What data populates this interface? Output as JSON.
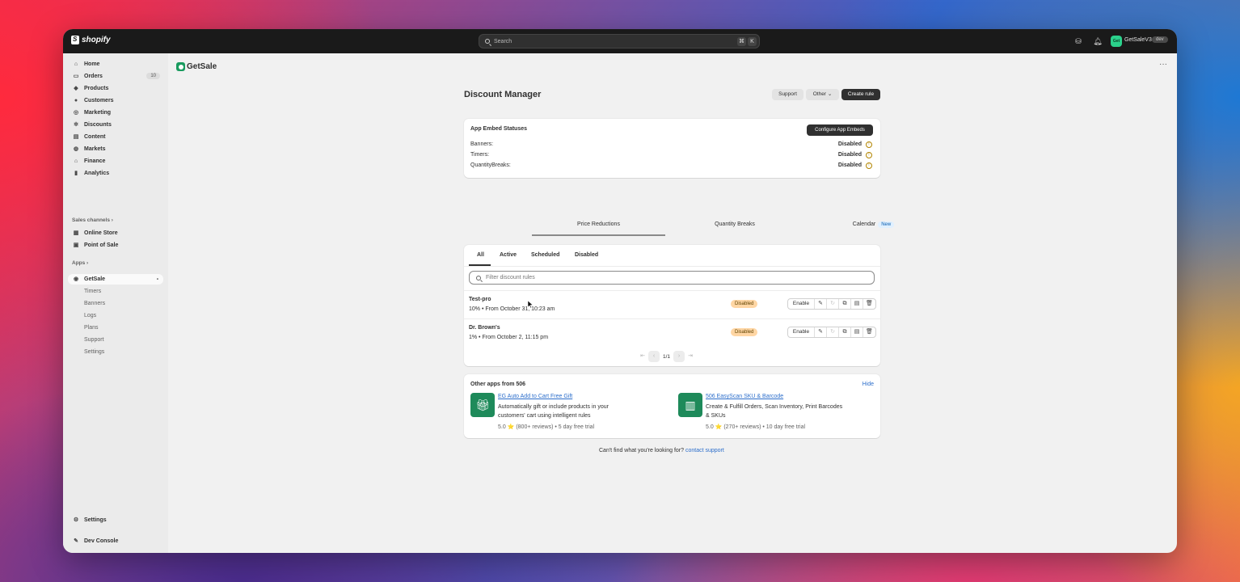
{
  "topbar": {
    "brand": "shopify",
    "search_placeholder": "Search",
    "shortcut_keys": [
      "⌘",
      "K"
    ],
    "store_avatar": "Get",
    "store_name": "GetSaleV3",
    "store_badge": "dev"
  },
  "sidebar": {
    "items": [
      {
        "label": "Home",
        "icon": "home-icon"
      },
      {
        "label": "Orders",
        "icon": "orders-icon",
        "count": "10"
      },
      {
        "label": "Products",
        "icon": "tag-icon"
      },
      {
        "label": "Customers",
        "icon": "person-icon"
      },
      {
        "label": "Marketing",
        "icon": "target-icon"
      },
      {
        "label": "Discounts",
        "icon": "discount-icon"
      },
      {
        "label": "Content",
        "icon": "content-icon"
      },
      {
        "label": "Markets",
        "icon": "globe-icon"
      },
      {
        "label": "Finance",
        "icon": "bank-icon"
      },
      {
        "label": "Analytics",
        "icon": "chart-icon"
      }
    ],
    "sales_channels_label": "Sales channels",
    "sales_channels": [
      {
        "label": "Online Store",
        "icon": "store-icon"
      },
      {
        "label": "Point of Sale",
        "icon": "pos-icon"
      }
    ],
    "apps_label": "Apps",
    "active_app": "GetSale",
    "app_subitems": [
      "Timers",
      "Banners",
      "Logs",
      "Plans",
      "Support",
      "Settings"
    ],
    "settings_label": "Settings",
    "dev_console_label": "Dev Console"
  },
  "app": {
    "name": "GetSale",
    "page_title": "Discount Manager",
    "support_button": "Support",
    "other_button": "Other",
    "create_button": "Create rule"
  },
  "embeds": {
    "title": "App Embed Statuses",
    "configure_button": "Configure App Embeds",
    "rows": [
      {
        "label": "Banners:",
        "status": "Disabled"
      },
      {
        "label": "Timers:",
        "status": "Disabled"
      },
      {
        "label": "QuantityBreaks:",
        "status": "Disabled"
      }
    ]
  },
  "main_tabs": {
    "price": "Price Reductions",
    "quantity": "Quantity Breaks",
    "calendar": "Calendar",
    "calendar_badge": "New"
  },
  "rules": {
    "subtabs": [
      "All",
      "Active",
      "Scheduled",
      "Disabled"
    ],
    "filter_placeholder": "Filter discount rules",
    "items": [
      {
        "name": "Test-pro",
        "meta": "10% • From October 31, 10:23 am",
        "status": "Disabled",
        "action": "Enable"
      },
      {
        "name": "Dr. Brown's",
        "meta": "1% • From October 2, 11:15 pm",
        "status": "Disabled",
        "action": "Enable"
      }
    ],
    "page_indicator": "1/1"
  },
  "other_apps": {
    "title": "Other apps from 506",
    "hide": "Hide",
    "apps": [
      {
        "name": "EG Auto Add to Cart Free Gift",
        "desc": "Automatically gift or include products in your customers' cart using intelligent rules",
        "rating": "5.0 ⭐ (800+ reviews) • 5 day free trial"
      },
      {
        "name": "506 EasyScan SKU & Barcode",
        "desc": "Create & Fulfill Orders, Scan Inventory, Print Barcodes & SKUs",
        "rating": "5.0 ⭐ (270+ reviews) • 10 day free trial"
      }
    ]
  },
  "footer": {
    "text": "Can't find what you're looking for?",
    "link": "contact support"
  }
}
